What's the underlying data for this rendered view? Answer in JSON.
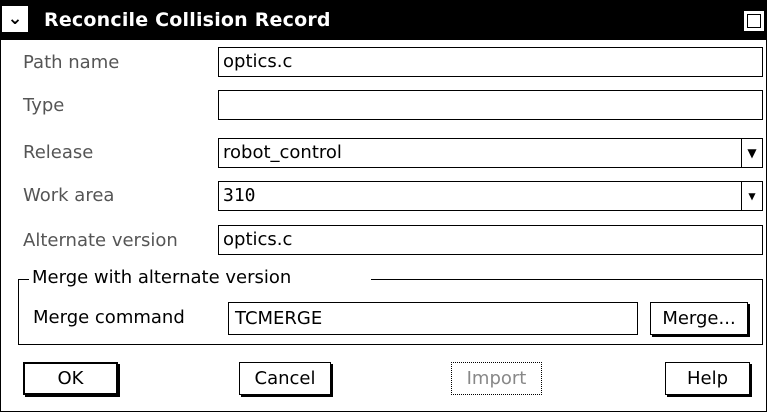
{
  "window": {
    "title": "Reconcile Collision Record",
    "sysmenu_glyph": "⌄"
  },
  "form": {
    "path_name": {
      "label": "Path name",
      "value": "optics.c"
    },
    "type": {
      "label": "Type",
      "value": ""
    },
    "release": {
      "label": "Release",
      "value": "robot_control"
    },
    "work_area": {
      "label": "Work area",
      "value": "310"
    },
    "alternate_version": {
      "label": "Alternate version",
      "value": "optics.c"
    }
  },
  "merge_group": {
    "title": "Merge with alternate version",
    "command_label": "Merge command",
    "command_value": "TCMERGE",
    "merge_button": "Merge..."
  },
  "buttons": {
    "ok": "OK",
    "cancel": "Cancel",
    "import": "Import",
    "help": "Help"
  },
  "icons": {
    "dropdown": "dropdown-arrow-icon",
    "sysmenu": "system-menu-icon",
    "maximize": "maximize-icon"
  }
}
